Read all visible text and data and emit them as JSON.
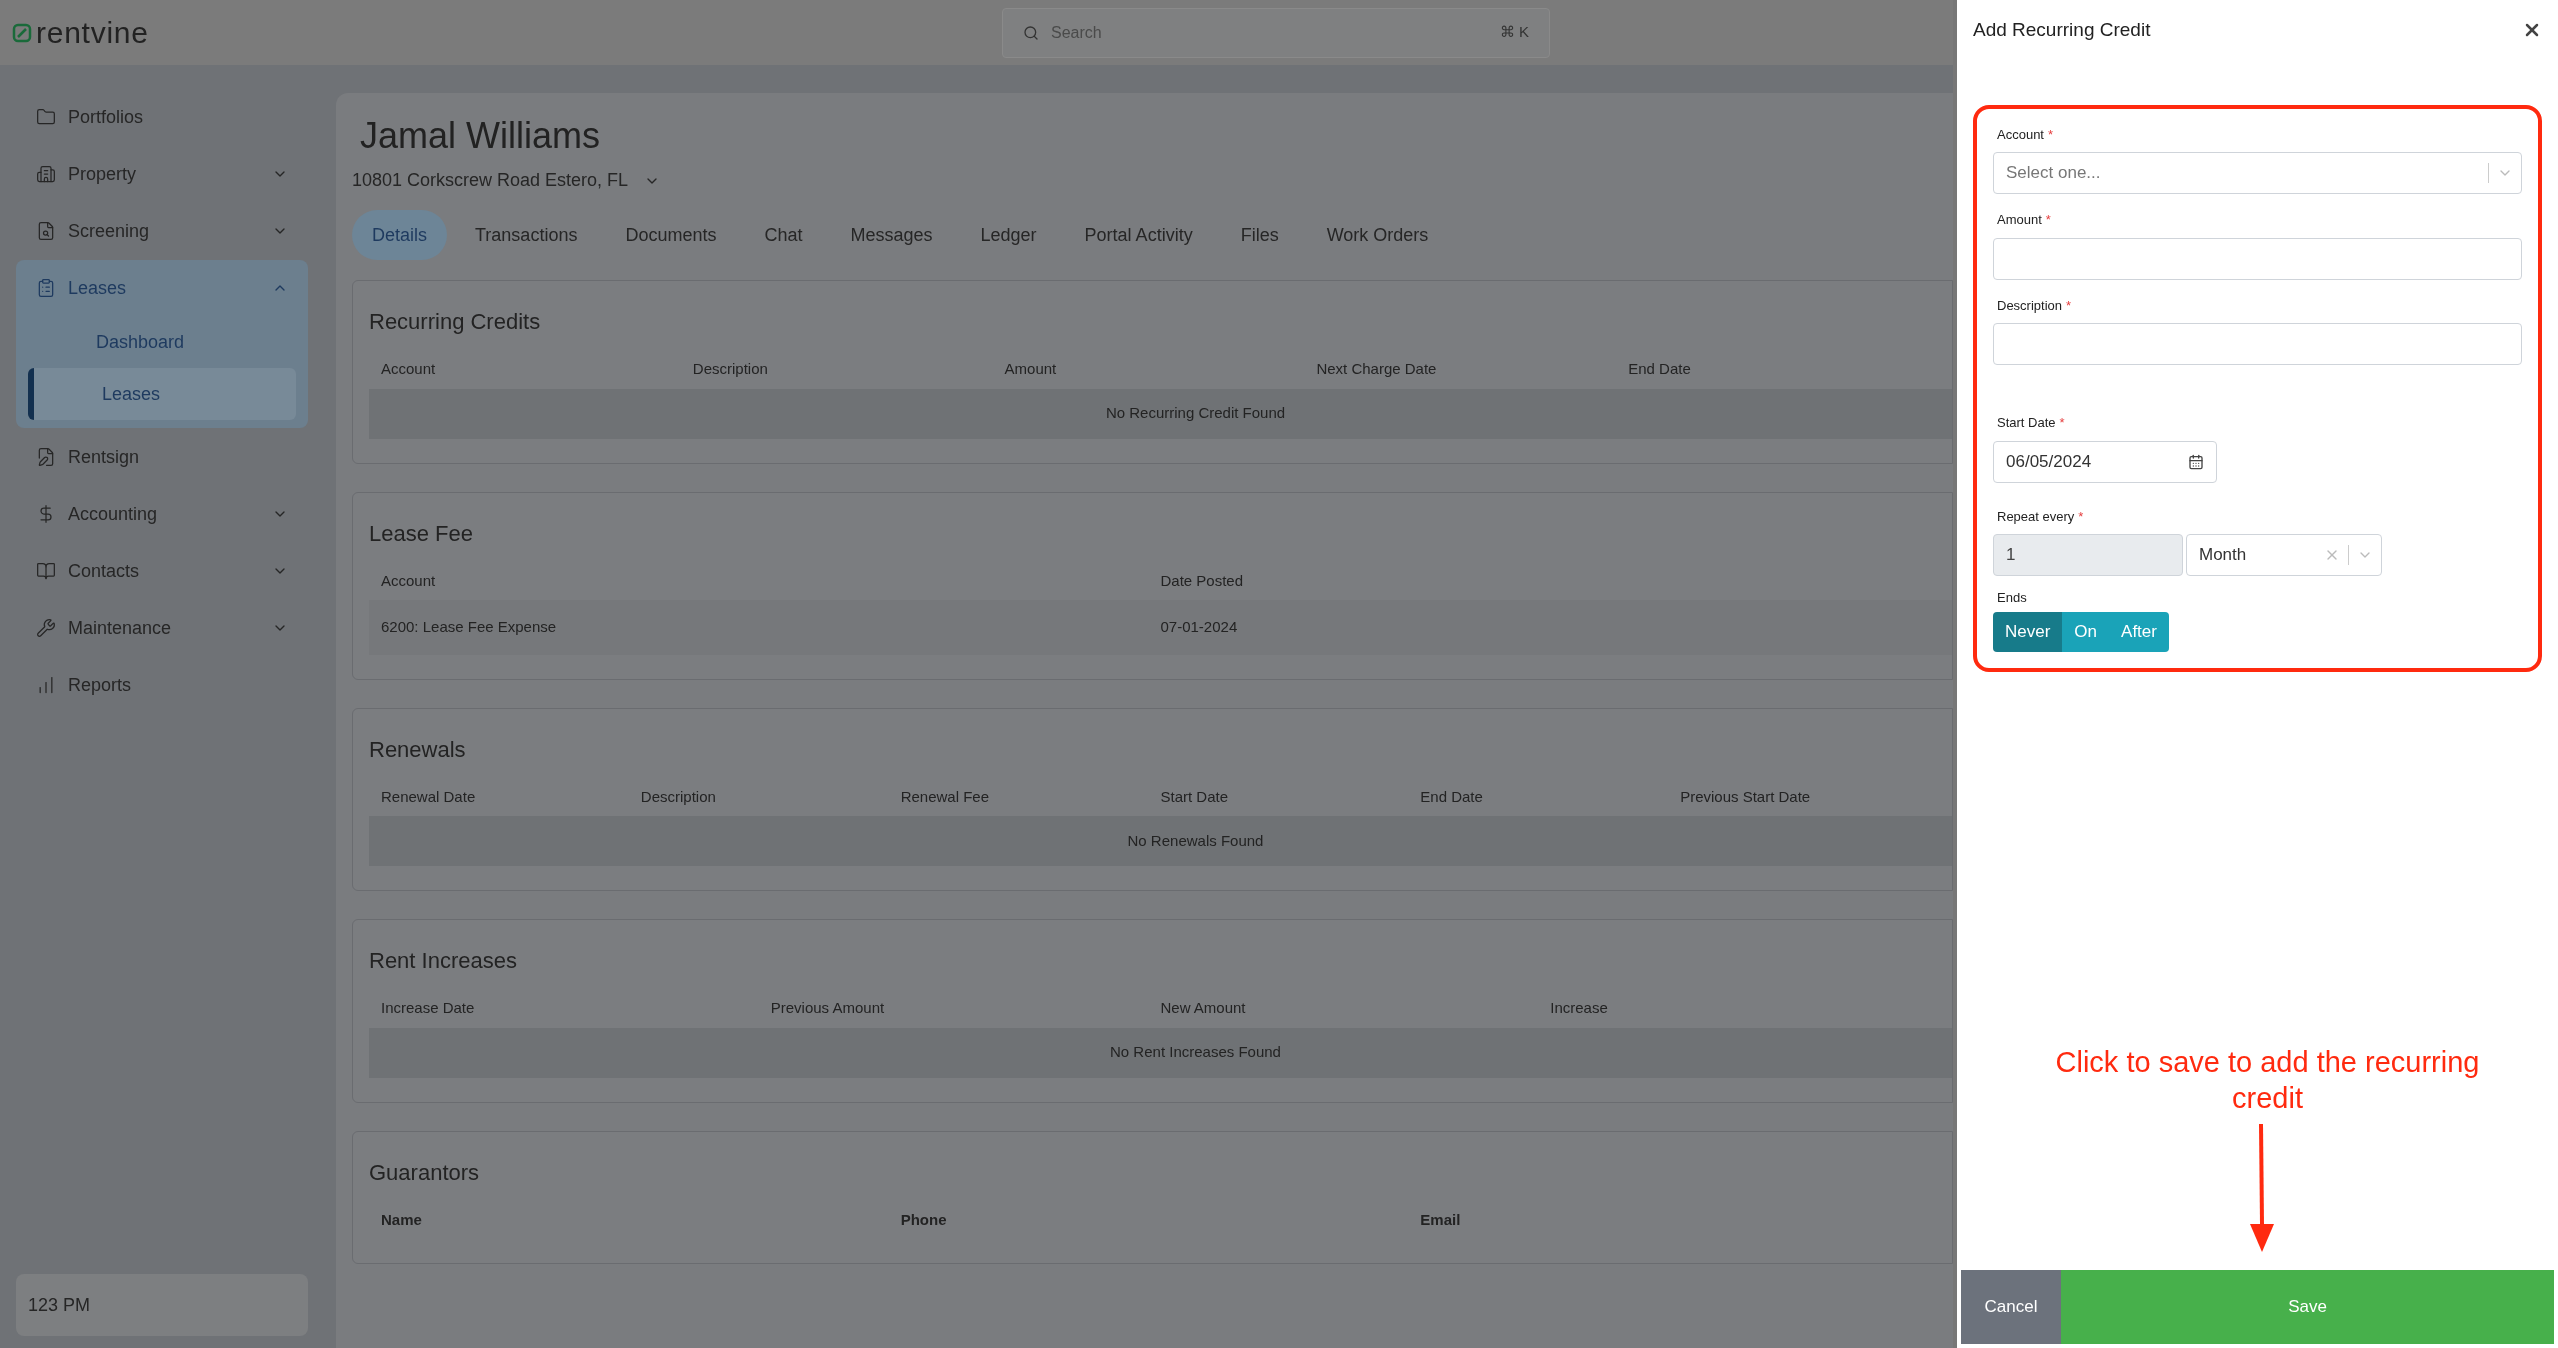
{
  "header": {
    "logo": "rentvine",
    "search": {
      "placeholder": "Search",
      "shortcut": "⌘ K"
    }
  },
  "sidebar": {
    "items": [
      {
        "label": "Portfolios",
        "kind": "link"
      },
      {
        "label": "Property",
        "kind": "menu",
        "expanded": false
      },
      {
        "label": "Screening",
        "kind": "menu",
        "expanded": false
      },
      {
        "label": "Leases",
        "kind": "menu",
        "expanded": true,
        "children": [
          {
            "label": "Dashboard",
            "selected": false
          },
          {
            "label": "Leases",
            "selected": true
          }
        ]
      },
      {
        "label": "Rentsign",
        "kind": "link"
      },
      {
        "label": "Accounting",
        "kind": "menu",
        "expanded": false
      },
      {
        "label": "Contacts",
        "kind": "menu",
        "expanded": false
      },
      {
        "label": "Maintenance",
        "kind": "menu",
        "expanded": false
      },
      {
        "label": "Reports",
        "kind": "link"
      }
    ],
    "footer": "123 PM"
  },
  "lease": {
    "tenant": "Jamal Williams",
    "address": "10801 Corkscrew Road Estero, FL",
    "tabs": [
      {
        "label": "Details",
        "selected": true
      },
      {
        "label": "Transactions",
        "selected": false
      },
      {
        "label": "Documents",
        "selected": false
      },
      {
        "label": "Chat",
        "selected": false
      },
      {
        "label": "Messages",
        "selected": false
      },
      {
        "label": "Ledger",
        "selected": false
      },
      {
        "label": "Portal Activity",
        "selected": false
      },
      {
        "label": "Files",
        "selected": false
      },
      {
        "label": "Work Orders",
        "selected": false
      }
    ],
    "sections": [
      {
        "kind": "table",
        "title": "Recurring Credits",
        "columns": [
          "Account",
          "Description",
          "Amount",
          "Next Charge Date",
          "End Date"
        ],
        "empty_message": "No Recurring Credit Found"
      },
      {
        "kind": "table",
        "title": "Lease Fee",
        "columns": [
          "Account",
          "Date Posted"
        ],
        "rows": [
          [
            "6200: Lease Fee Expense",
            "07-01-2024"
          ]
        ]
      },
      {
        "kind": "table",
        "title": "Renewals",
        "columns": [
          "Renewal Date",
          "Description",
          "Renewal Fee",
          "Start Date",
          "End Date",
          "Previous Start Date"
        ],
        "empty_message": "No Renewals Found"
      },
      {
        "kind": "table",
        "title": "Rent Increases",
        "columns": [
          "Increase Date",
          "Previous Amount",
          "New Amount",
          "Increase"
        ],
        "empty_message": "No Rent Increases Found"
      },
      {
        "kind": "contacts",
        "title": "Guarantors",
        "columns": [
          "Name",
          "Phone",
          "Email"
        ]
      }
    ]
  },
  "drawer": {
    "title": "Add Recurring Credit",
    "fields": [
      {
        "kind": "select",
        "label": "Account",
        "required_mark": "*",
        "placeholder": "Select one..."
      },
      {
        "kind": "text",
        "label": "Amount",
        "required_mark": "*"
      },
      {
        "kind": "text",
        "label": "Description",
        "required_mark": "*"
      },
      {
        "kind": "date",
        "label": "Start Date",
        "required_mark": "*",
        "value": "06/05/2024"
      },
      {
        "kind": "repeat",
        "label": "Repeat every",
        "required_mark": "*",
        "value": "1",
        "unit": "Month"
      },
      {
        "kind": "segmented",
        "label": "Ends",
        "options": [
          {
            "label": "Never",
            "selected": true
          },
          {
            "label": "On",
            "selected": false
          },
          {
            "label": "After",
            "selected": false
          }
        ]
      }
    ],
    "annotation": "Click to save to add the recurring credit",
    "buttons": [
      {
        "label": "Cancel",
        "kind": "secondary"
      },
      {
        "label": "Save",
        "kind": "primary"
      }
    ]
  }
}
